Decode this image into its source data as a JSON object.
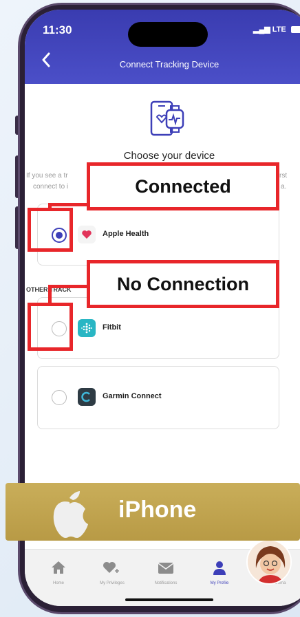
{
  "status_bar": {
    "time": "11:30",
    "network": "LTE"
  },
  "header": {
    "title": "Connect Tracking Device"
  },
  "choose": {
    "title": "Choose your device",
    "desc_line1_left": "If you see a tr",
    "desc_line1_right": "rst",
    "desc_line2_left": "connect to i",
    "desc_line2_right": "a."
  },
  "devices": [
    {
      "name": "Apple Health",
      "selected": true,
      "icon": "heart-icon"
    },
    {
      "name": "Fitbit",
      "selected": false,
      "icon": "fitbit-icon"
    },
    {
      "name": "Garmin Connect",
      "selected": false,
      "icon": "garmin-icon"
    }
  ],
  "section_label": "OTHER TRACK",
  "annotations": {
    "connected": "Connected",
    "no_connection": "No Connection"
  },
  "banner": {
    "text": "iPhone"
  },
  "tabbar": [
    {
      "label": "Home",
      "icon": "home-icon",
      "active": false
    },
    {
      "label": "My Privileges",
      "icon": "heart-plus-icon",
      "active": false
    },
    {
      "label": "Notifications",
      "icon": "envelope-icon",
      "active": false
    },
    {
      "label": "My Profile",
      "icon": "person-icon",
      "active": true
    },
    {
      "label": "Ask Emma",
      "icon": "avatar",
      "active": false
    }
  ],
  "colors": {
    "primary": "#3d3fb8",
    "annotation": "#e8262a",
    "banner": "#c2a652"
  }
}
